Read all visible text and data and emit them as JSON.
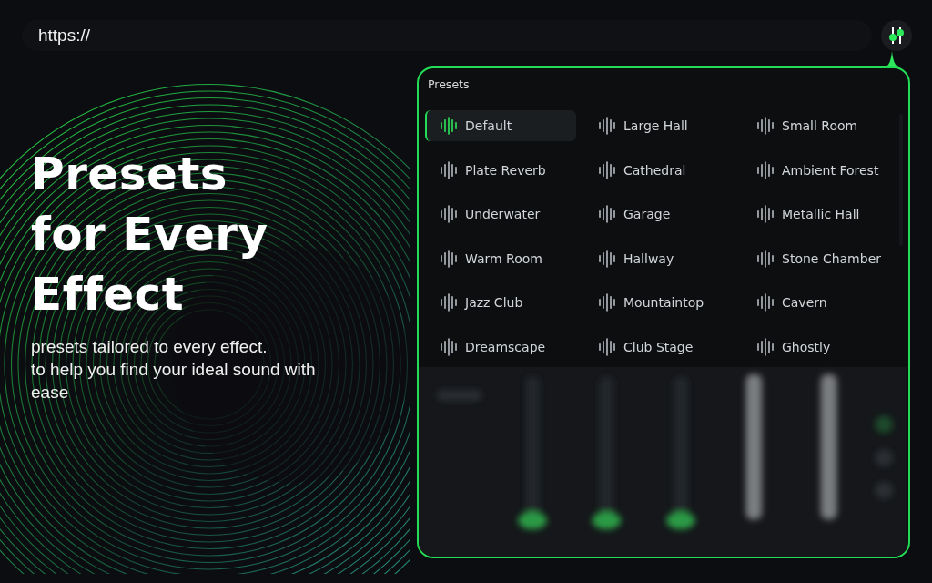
{
  "address_bar": {
    "url": "https://"
  },
  "hero": {
    "title_lines": [
      "Presets",
      "for Every",
      "Effect"
    ],
    "subtitle_lines": [
      "presets tailored to every effect.",
      "to help you find your ideal sound with ease"
    ]
  },
  "presets_panel": {
    "title": "Presets",
    "items": [
      {
        "label": "Default",
        "selected": true
      },
      {
        "label": "Large Hall",
        "selected": false
      },
      {
        "label": "Small Room",
        "selected": false
      },
      {
        "label": "Plate Reverb",
        "selected": false
      },
      {
        "label": "Cathedral",
        "selected": false
      },
      {
        "label": "Ambient Forest",
        "selected": false
      },
      {
        "label": "Underwater",
        "selected": false
      },
      {
        "label": "Garage",
        "selected": false
      },
      {
        "label": "Metallic Hall",
        "selected": false
      },
      {
        "label": "Warm Room",
        "selected": false
      },
      {
        "label": "Hallway",
        "selected": false
      },
      {
        "label": "Stone Chamber",
        "selected": false
      },
      {
        "label": "Jazz Club",
        "selected": false
      },
      {
        "label": "Mountaintop",
        "selected": false
      },
      {
        "label": "Cavern",
        "selected": false
      },
      {
        "label": "Dreamscape",
        "selected": false
      },
      {
        "label": "Club Stage",
        "selected": false
      },
      {
        "label": "Ghostly",
        "selected": false
      }
    ]
  }
}
